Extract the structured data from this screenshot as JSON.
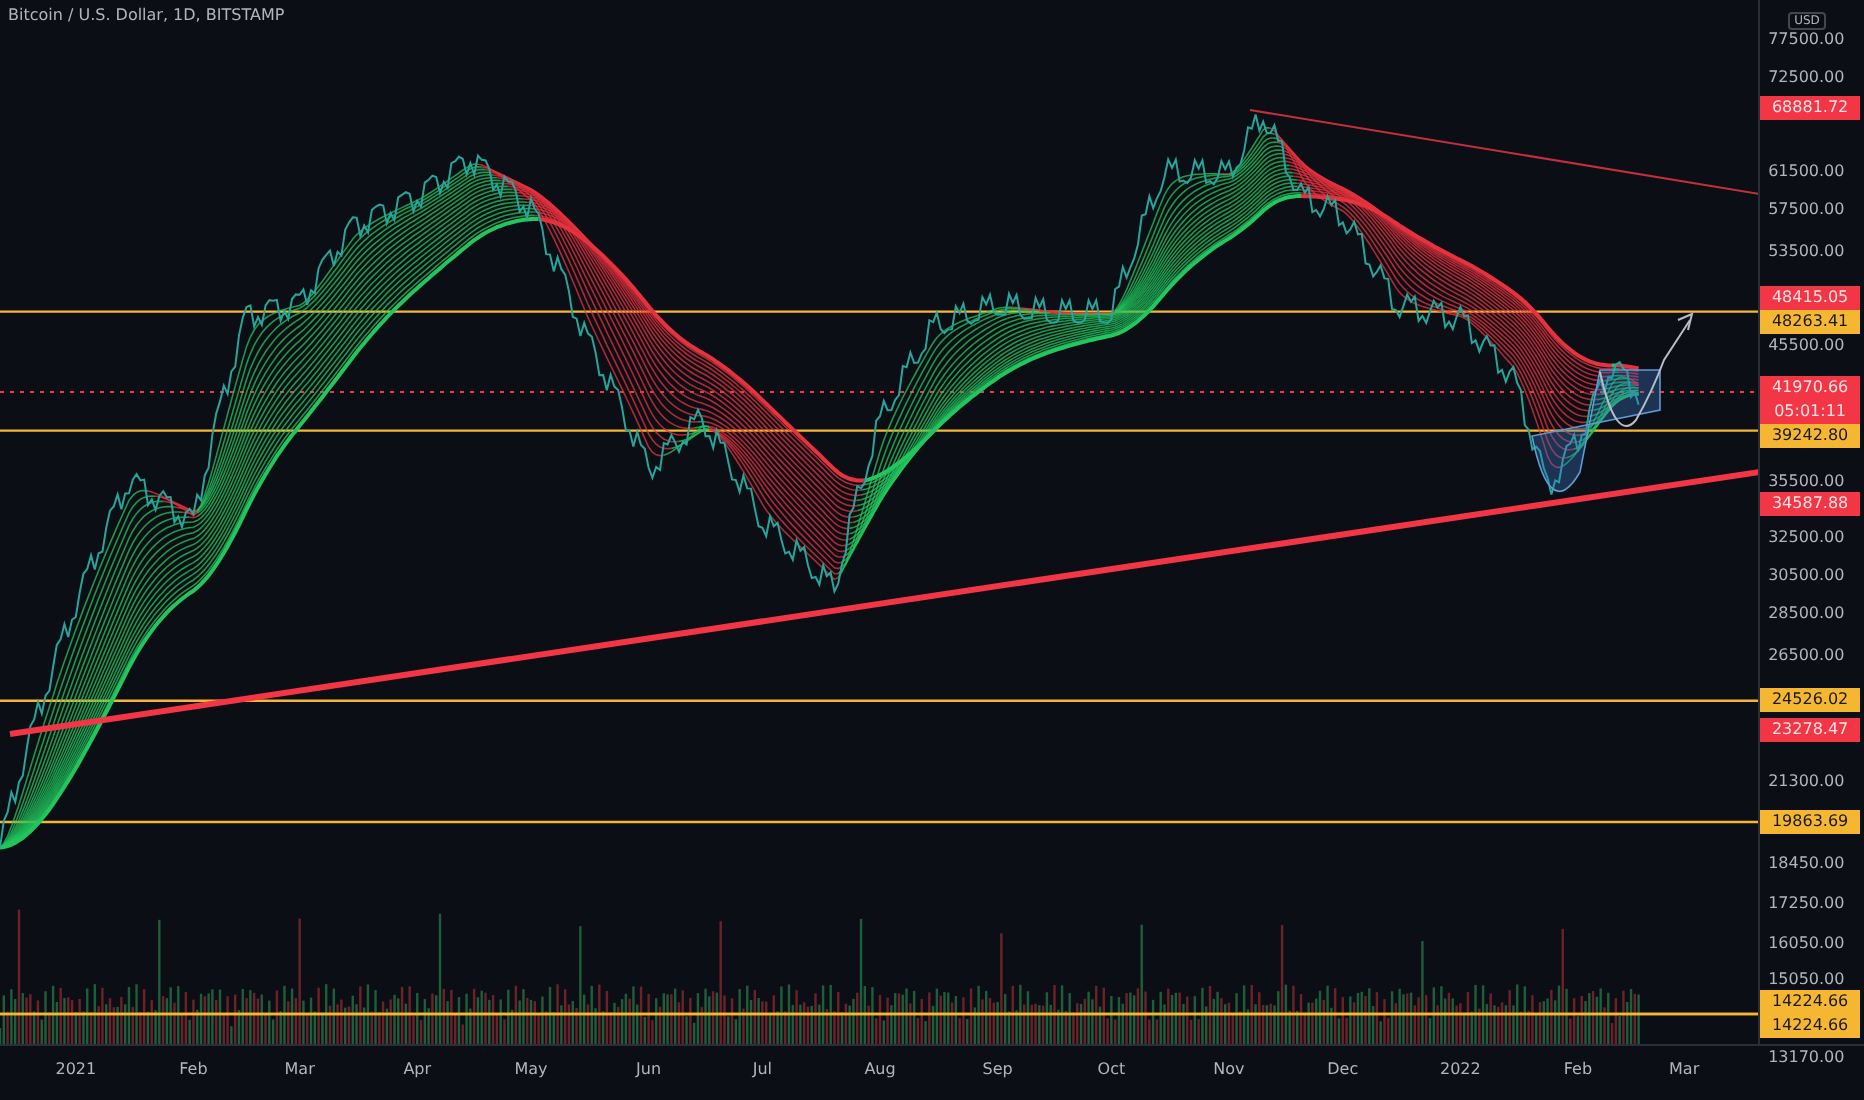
{
  "header": {
    "title": "Bitcoin / U.S. Dollar, 1D, BITSTAMP"
  },
  "chart": {
    "currency": "USD",
    "price_axis": [
      "77500.00",
      "72500.00",
      "61500.00",
      "57500.00",
      "53500.00",
      "45500.00",
      "35500.00",
      "32500.00",
      "30500.00",
      "28500.00",
      "26500.00",
      "21300.00",
      "18450.00",
      "17250.00",
      "16050.00",
      "15050.00",
      "13170.00"
    ],
    "time_axis": [
      "2021",
      "Feb",
      "Mar",
      "Apr",
      "May",
      "Jun",
      "Jul",
      "Aug",
      "Sep",
      "Oct",
      "Nov",
      "Dec",
      "2022",
      "Feb",
      "Mar"
    ],
    "price_tags": [
      {
        "label": "68881.72",
        "kind": "alert"
      },
      {
        "label": "48415.05",
        "kind": "alert"
      },
      {
        "label": "48263.41",
        "kind": "level"
      },
      {
        "label": "41970.66",
        "kind": "last",
        "countdown": "05:01:11"
      },
      {
        "label": "39242.80",
        "kind": "level"
      },
      {
        "label": "34587.88",
        "kind": "alert"
      },
      {
        "label": "24526.02",
        "kind": "level"
      },
      {
        "label": "23278.47",
        "kind": "alert"
      },
      {
        "label": "19863.69",
        "kind": "level"
      },
      {
        "label": "14224.66",
        "kind": "level"
      },
      {
        "label": "14224.66",
        "kind": "level"
      }
    ]
  }
}
